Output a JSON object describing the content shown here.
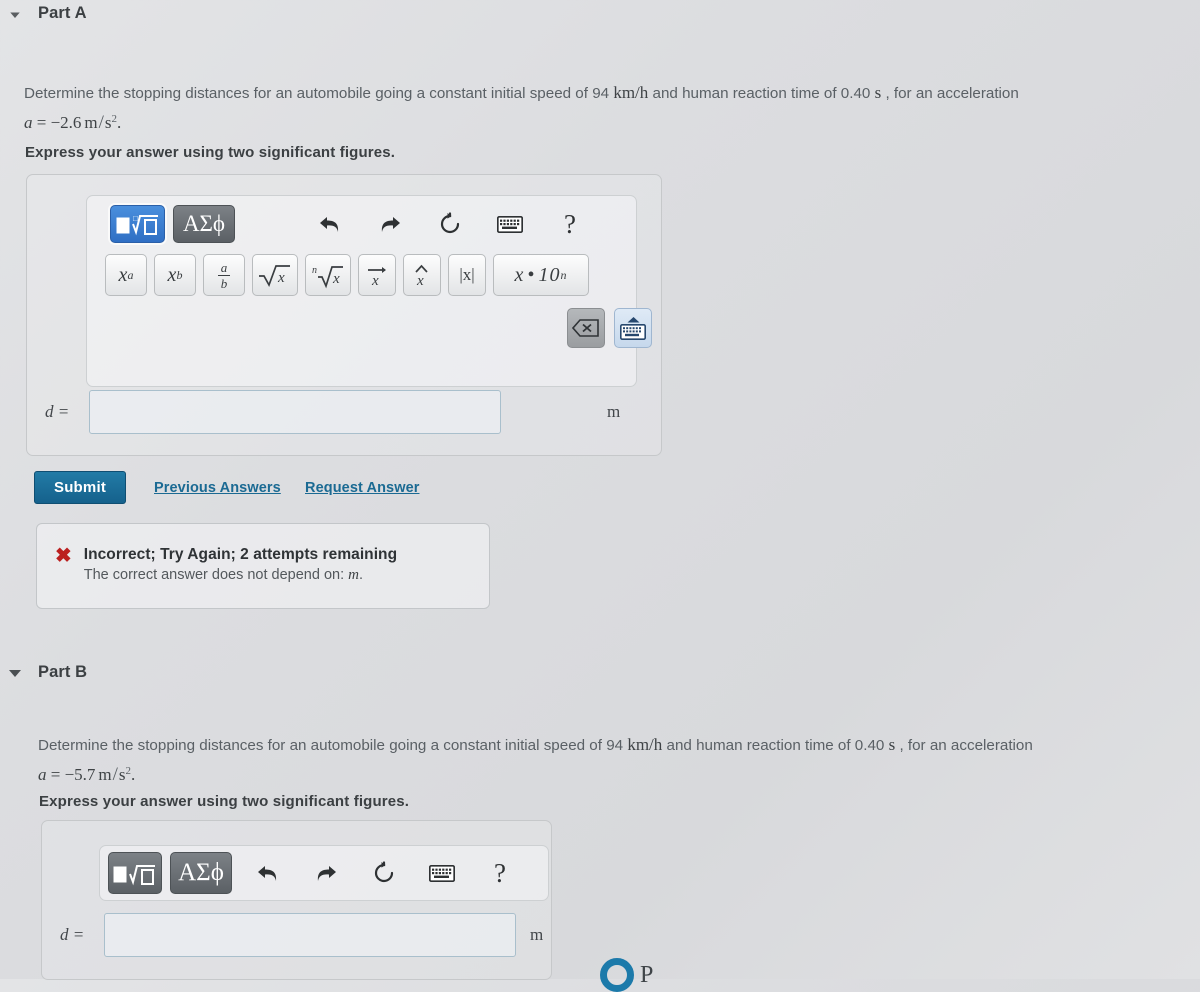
{
  "parts": [
    {
      "id": "A",
      "title": "Part A",
      "disclosure_icon": "triangle-down-icon",
      "question": {
        "lead": "Determine the stopping distances for an automobile going a constant initial speed of 94",
        "unit_speed": "km/h",
        "mid": "and human reaction time of 0.40",
        "unit_time": "s",
        "tail": ", for an acceleration",
        "accel_var": "a",
        "accel_eq": "=",
        "accel_value": "−2.6",
        "accel_unit_num": "m",
        "accel_unit_slash": "/",
        "accel_unit_den": "s",
        "accel_unit_exp": "2",
        "accel_period": "."
      },
      "instruction": "Express your answer using two significant figures.",
      "toolbar": {
        "template_button": "template-picker",
        "greek_button": "ΑΣϕ",
        "undo_icon": "undo-arrow-icon",
        "redo_icon": "redo-arrow-icon",
        "reset_icon": "reset-circular-arrow-icon",
        "keyboard_icon": "keyboard-icon",
        "help_icon": "question-mark-icon",
        "symbols": [
          {
            "name": "superscript-button",
            "label": "x^a"
          },
          {
            "name": "subscript-button",
            "label": "x_b"
          },
          {
            "name": "fraction-button",
            "numerator": "a",
            "denominator": "b"
          },
          {
            "name": "square-root-button",
            "label": "√x"
          },
          {
            "name": "nth-root-button",
            "label": "ⁿhe√x"
          },
          {
            "name": "vector-button",
            "label": "x⃗"
          },
          {
            "name": "unit-vector-button",
            "label": "x̂"
          },
          {
            "name": "absolute-value-button",
            "label": "|x|"
          },
          {
            "name": "scientific-notation-button",
            "label": "x•10ⁿ"
          }
        ],
        "backspace_icon": "backspace-icon",
        "show-keyboard_icon": "keyboard-up-icon"
      },
      "answer": {
        "label": "d =",
        "value": "",
        "placeholder": "",
        "unit": "m"
      },
      "actions": {
        "submit_label": "Submit",
        "previous_answers_label": "Previous Answers",
        "request_answer_label": "Request Answer"
      },
      "feedback": {
        "icon": "red-x-icon",
        "title": "Incorrect; Try Again; 2 attempts remaining",
        "subtitle_pre": "The correct answer does not depend on:",
        "subtitle_var": "m",
        "subtitle_post": "."
      }
    },
    {
      "id": "B",
      "title": "Part B",
      "disclosure_icon": "triangle-down-icon",
      "question": {
        "lead": "Determine the stopping distances for an automobile going a constant initial speed of 94",
        "unit_speed": "km/h",
        "mid": "and human reaction time of 0.40",
        "unit_time": "s",
        "tail": ", for an acceleration",
        "accel_var": "a",
        "accel_eq": "=",
        "accel_value": "−5.7",
        "accel_unit_num": "m",
        "accel_unit_slash": "/",
        "accel_unit_den": "s",
        "accel_unit_exp": "2",
        "accel_period": "."
      },
      "instruction": "Express your answer using two significant figures.",
      "toolbar": {
        "template_button": "template-picker",
        "greek_button": "ΑΣϕ",
        "undo_icon": "undo-arrow-icon",
        "redo_icon": "redo-arrow-icon",
        "reset_icon": "reset-circular-arrow-icon",
        "keyboard_icon": "keyboard-icon",
        "help_icon": "question-mark-icon"
      },
      "answer": {
        "label": "d =",
        "value": "",
        "placeholder": "",
        "unit": "m"
      }
    }
  ],
  "bottom_mark": {
    "icon": "blue-ring-icon",
    "word": "P"
  },
  "colors": {
    "page_background": "#dcdde0",
    "submit_blue": "#15618c",
    "link_blue": "#1b6a93",
    "primary_button_blue": "#2f6fc4",
    "error_red": "#bb1f1f",
    "text_gray": "#5a6065"
  }
}
